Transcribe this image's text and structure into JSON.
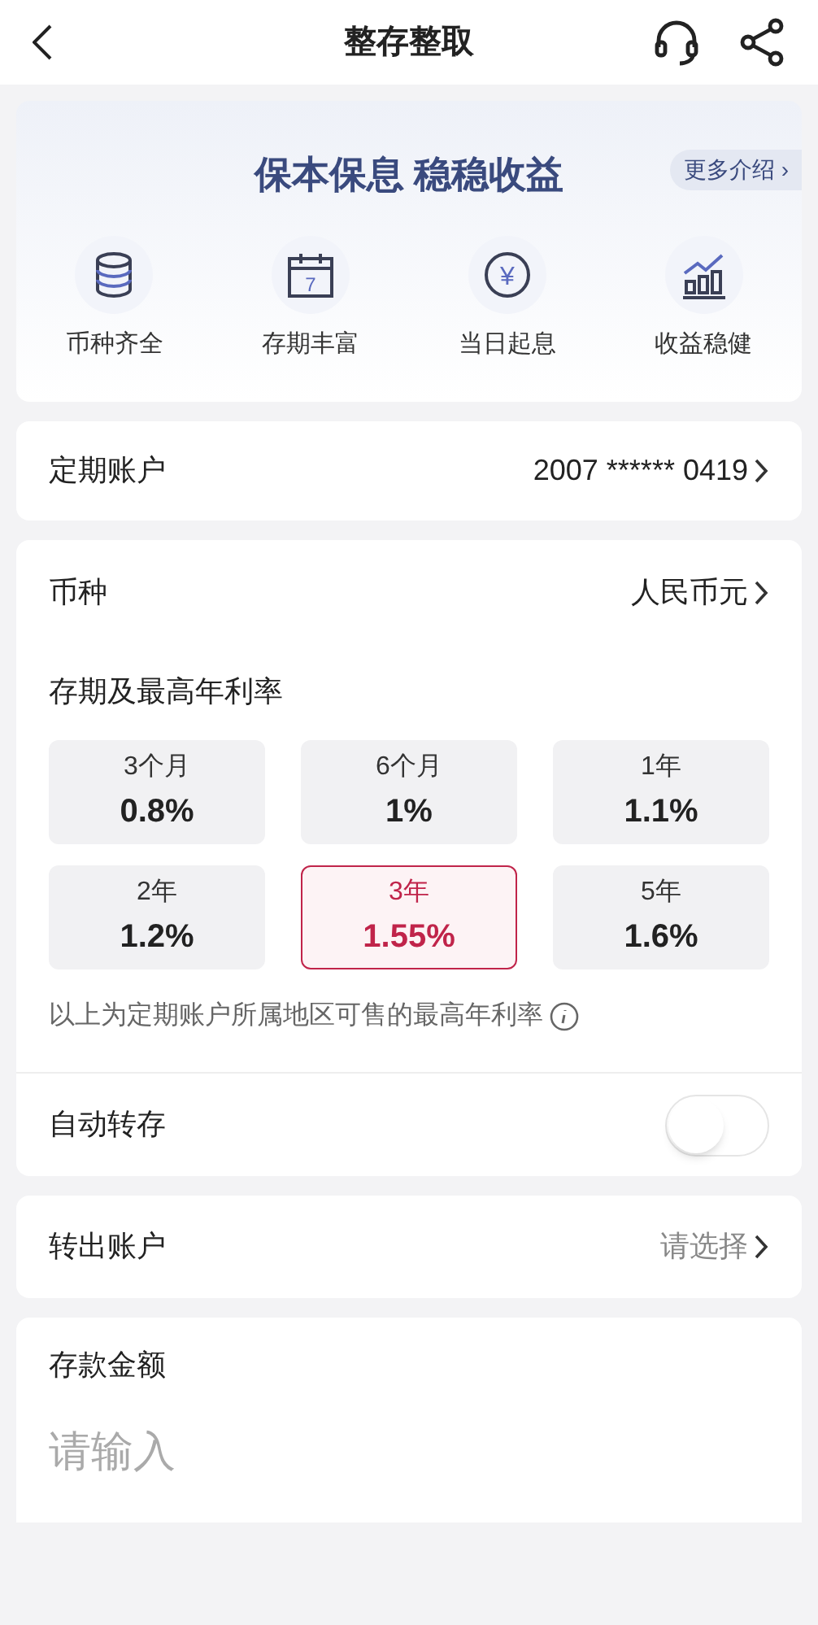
{
  "header": {
    "title": "整存整取"
  },
  "banner": {
    "slogan": "保本保息 稳稳收益",
    "more": "更多介绍 ›",
    "features": [
      {
        "kind": "coins",
        "label": "币种齐全"
      },
      {
        "kind": "calendar",
        "label": "存期丰富",
        "day": "7"
      },
      {
        "kind": "yen",
        "label": "当日起息",
        "symbol": "¥"
      },
      {
        "kind": "chart",
        "label": "收益稳健"
      }
    ]
  },
  "account": {
    "label": "定期账户",
    "value": "2007 ****** 0419"
  },
  "currency": {
    "label": "币种",
    "value": "人民币元"
  },
  "terms": {
    "title": "存期及最高年利率",
    "options": [
      {
        "term": "3个月",
        "rate": "0.8%",
        "selected": false
      },
      {
        "term": "6个月",
        "rate": "1%",
        "selected": false
      },
      {
        "term": "1年",
        "rate": "1.1%",
        "selected": false
      },
      {
        "term": "2年",
        "rate": "1.2%",
        "selected": false
      },
      {
        "term": "3年",
        "rate": "1.55%",
        "selected": true
      },
      {
        "term": "5年",
        "rate": "1.6%",
        "selected": false
      }
    ],
    "note": "以上为定期账户所属地区可售的最高年利率"
  },
  "auto_renew": {
    "label": "自动转存",
    "on": false
  },
  "source_account": {
    "label": "转出账户",
    "placeholder": "请选择"
  },
  "amount": {
    "label": "存款金额",
    "placeholder": "请输入"
  }
}
